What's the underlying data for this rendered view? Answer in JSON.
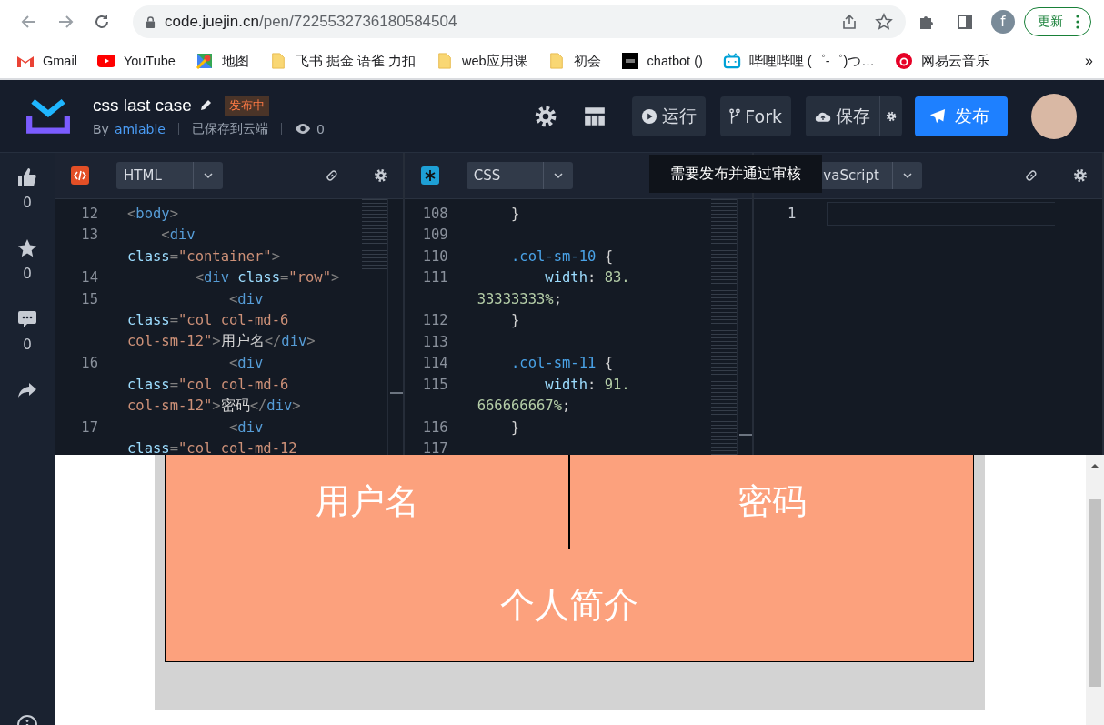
{
  "browser": {
    "url_host": "code.juejin.cn",
    "url_path": "/pen/7225532736180584504",
    "profile_initial": "f",
    "update_button": "更新",
    "more": "»",
    "bookmarks": [
      {
        "kind": "gmail",
        "label": "Gmail"
      },
      {
        "kind": "youtube",
        "label": "YouTube"
      },
      {
        "kind": "maps",
        "label": "地图"
      },
      {
        "kind": "folder",
        "label": "飞书 掘金 语雀 力扣"
      },
      {
        "kind": "folder",
        "label": "web应用课"
      },
      {
        "kind": "folder",
        "label": "初会"
      },
      {
        "kind": "chatbot",
        "label": "chatbot ()"
      },
      {
        "kind": "bilibili",
        "label": "哔哩哔哩 (゜-゜)つ…"
      },
      {
        "kind": "netease",
        "label": "网易云音乐"
      }
    ]
  },
  "header": {
    "title": "css last case",
    "status_badge": "发布中",
    "by": "By",
    "author": "amiable",
    "save_state": "已保存到云端",
    "views": "0",
    "buttons": [
      {
        "kind": "run",
        "label": "运行"
      },
      {
        "kind": "fork",
        "label": "Fork"
      },
      {
        "kind": "save",
        "label": "保存"
      },
      {
        "kind": "publish",
        "label": "发布"
      }
    ]
  },
  "sidebar": [
    {
      "kind": "like",
      "count": "0"
    },
    {
      "kind": "star",
      "count": "0"
    },
    {
      "kind": "comment",
      "count": "0"
    },
    {
      "kind": "share"
    }
  ],
  "tooltip": "需要发布并通过审核",
  "editors": [
    {
      "kind": "html",
      "language": "HTML",
      "lines": [
        {
          "num": "12",
          "tokens": [
            {
              "kind": "punct",
              "text": "<"
            },
            {
              "kind": "tag",
              "text": "body"
            },
            {
              "kind": "punct",
              "text": ">"
            }
          ]
        },
        {
          "num": "13",
          "tokens": [
            {
              "kind": "punct",
              "text": "    <"
            },
            {
              "kind": "tag",
              "text": "div"
            }
          ]
        },
        {
          "tokens": [
            {
              "kind": "attr",
              "text": "class"
            },
            {
              "kind": "punct",
              "text": "="
            },
            {
              "kind": "str",
              "text": "\"container\""
            },
            {
              "kind": "punct",
              "text": ">"
            }
          ]
        },
        {
          "num": "14",
          "tokens": [
            {
              "kind": "punct",
              "text": "        <"
            },
            {
              "kind": "tag",
              "text": "div"
            },
            {
              "kind": "attr",
              "text": " class"
            },
            {
              "kind": "punct",
              "text": "="
            },
            {
              "kind": "str",
              "text": "\"row\""
            },
            {
              "kind": "punct",
              "text": ">"
            }
          ]
        },
        {
          "num": "15",
          "tokens": [
            {
              "kind": "punct",
              "text": "            <"
            },
            {
              "kind": "tag",
              "text": "div"
            }
          ]
        },
        {
          "tokens": [
            {
              "kind": "attr",
              "text": "class"
            },
            {
              "kind": "punct",
              "text": "="
            },
            {
              "kind": "str",
              "text": "\"col col-md-6"
            }
          ]
        },
        {
          "tokens": [
            {
              "kind": "str",
              "text": "col-sm-12\""
            },
            {
              "kind": "punct",
              "text": ">"
            },
            {
              "kind": "text",
              "text": "用户名"
            },
            {
              "kind": "punct",
              "text": "</"
            },
            {
              "kind": "tag",
              "text": "div"
            },
            {
              "kind": "punct",
              "text": ">"
            }
          ]
        },
        {
          "num": "16",
          "tokens": [
            {
              "kind": "punct",
              "text": "            <"
            },
            {
              "kind": "tag",
              "text": "div"
            }
          ]
        },
        {
          "tokens": [
            {
              "kind": "attr",
              "text": "class"
            },
            {
              "kind": "punct",
              "text": "="
            },
            {
              "kind": "str",
              "text": "\"col col-md-6"
            }
          ]
        },
        {
          "tokens": [
            {
              "kind": "str",
              "text": "col-sm-12\""
            },
            {
              "kind": "punct",
              "text": ">"
            },
            {
              "kind": "text",
              "text": "密码"
            },
            {
              "kind": "punct",
              "text": "</"
            },
            {
              "kind": "tag",
              "text": "div"
            },
            {
              "kind": "punct",
              "text": ">"
            }
          ]
        },
        {
          "num": "17",
          "tokens": [
            {
              "kind": "punct",
              "text": "            <"
            },
            {
              "kind": "tag",
              "text": "div"
            }
          ]
        },
        {
          "tokens": [
            {
              "kind": "attr",
              "text": "class"
            },
            {
              "kind": "punct",
              "text": "="
            },
            {
              "kind": "str",
              "text": "\"col col-md-12"
            }
          ]
        }
      ]
    },
    {
      "kind": "css",
      "language": "CSS",
      "lines": [
        {
          "num": "108",
          "tokens": [
            {
              "kind": "text",
              "text": "    }"
            }
          ]
        },
        {
          "num": "109"
        },
        {
          "num": "110",
          "tokens": [
            {
              "kind": "sel",
              "text": "    .col-sm-10"
            },
            {
              "kind": "text",
              "text": " {"
            }
          ]
        },
        {
          "num": "111",
          "tokens": [
            {
              "kind": "prop",
              "text": "        width"
            },
            {
              "kind": "text",
              "text": ":"
            },
            {
              "kind": "num",
              "text": " 83."
            }
          ]
        },
        {
          "tokens": [
            {
              "kind": "num",
              "text": "33333333%"
            },
            {
              "kind": "text",
              "text": ";"
            }
          ]
        },
        {
          "num": "112",
          "tokens": [
            {
              "kind": "text",
              "text": "    }"
            }
          ]
        },
        {
          "num": "113"
        },
        {
          "num": "114",
          "tokens": [
            {
              "kind": "sel",
              "text": "    .col-sm-11"
            },
            {
              "kind": "text",
              "text": " {"
            }
          ]
        },
        {
          "num": "115",
          "tokens": [
            {
              "kind": "prop",
              "text": "        width"
            },
            {
              "kind": "text",
              "text": ":"
            },
            {
              "kind": "num",
              "text": " 91."
            }
          ]
        },
        {
          "tokens": [
            {
              "kind": "num",
              "text": "666666667%"
            },
            {
              "kind": "text",
              "text": ";"
            }
          ]
        },
        {
          "num": "116",
          "tokens": [
            {
              "kind": "text",
              "text": "    }"
            }
          ]
        },
        {
          "num": "117"
        }
      ]
    },
    {
      "kind": "js",
      "language": "vaScript",
      "lines": [
        {
          "num": "1"
        }
      ]
    }
  ],
  "preview": {
    "cells": [
      {
        "kind": "half",
        "text": "用户名"
      },
      {
        "kind": "half",
        "text": "密码"
      },
      {
        "kind": "full",
        "text": "个人简介"
      }
    ]
  }
}
